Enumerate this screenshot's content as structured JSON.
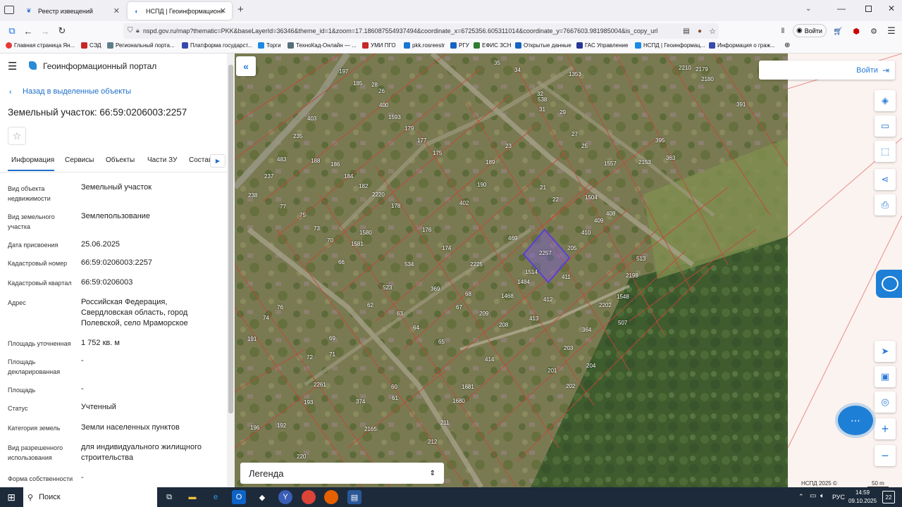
{
  "browser": {
    "tabs": [
      {
        "label": "Реестр извещений",
        "close": "✕"
      },
      {
        "label": "НСПД | Геоинформационный",
        "close": "✕"
      }
    ],
    "new_tab": "+",
    "url": "nspd.gov.ru/map?thematic=PKK&baseLayerId=36346&theme_id=1&zoom=17.186087554937494&coordinate_x=6725356.605311014&coordinate_y=7667603.981985004&is_copy_url",
    "account_label": "Войти",
    "bookmarks": [
      {
        "label": "Главная страница Ян...",
        "color": "#e53935"
      },
      {
        "label": "СЭД",
        "color": "#c62828"
      },
      {
        "label": "Региональный портa...",
        "color": "#607d8b"
      },
      {
        "label": "Платформа государст...",
        "color": "#3949ab"
      },
      {
        "label": "Торги",
        "color": "#1e88e5"
      },
      {
        "label": "ТехноКад-Онлайн — ...",
        "color": "#546e7a"
      },
      {
        "label": "УМИ ПГО",
        "color": "#c62828"
      },
      {
        "label": "pkk.rosreestr",
        "color": "#1976d2"
      },
      {
        "label": "РГУ",
        "color": "#1565c0"
      },
      {
        "label": "ЕФИС ЗСН",
        "color": "#2e7d32"
      },
      {
        "label": "Открытые данные",
        "color": "#1565c0"
      },
      {
        "label": "ГАС Управление",
        "color": "#283593"
      },
      {
        "label": "НСПД | Геоинформац...",
        "color": "#1e88e5"
      },
      {
        "label": "Информация о граж...",
        "color": "#3949ab"
      }
    ]
  },
  "panel": {
    "portal_title": "Геоинформационный портал",
    "back_link": "Назад в выделенные объекты",
    "object_title": "Земельный участок: 66:59:0206003:2257",
    "tabs": [
      "Информация",
      "Сервисы",
      "Объекты",
      "Части ЗУ",
      "Состав"
    ],
    "fields": [
      {
        "label": "Вид объекта недвижимости",
        "value": "Земельный участок"
      },
      {
        "label": "Вид земельного участка",
        "value": "Землепользование"
      },
      {
        "label": "Дата присвоения",
        "value": "25.06.2025"
      },
      {
        "label": "Кадастровый номер",
        "value": "66:59:0206003:2257"
      },
      {
        "label": "Кадастровый квартал",
        "value": "66:59:0206003"
      },
      {
        "label": "Адрес",
        "value": "Российская Федерация, Свердловская область, город Полевской, село Мраморское"
      },
      {
        "label": "Площадь уточненная",
        "value": "1 752 кв. м"
      },
      {
        "label": "Площадь декларированная",
        "value": "-"
      },
      {
        "label": "Площадь",
        "value": "-"
      },
      {
        "label": "Статус",
        "value": "Учтенный"
      },
      {
        "label": "Категория земель",
        "value": "Земли населенных пунктов"
      },
      {
        "label": "Вид разрешенного использования",
        "value": "для индивидуального жилищного строительства"
      },
      {
        "label": "Форма собственности",
        "value": "-"
      }
    ]
  },
  "map": {
    "login_label": "Войти",
    "legend_label": "Легенда",
    "selected_plot": "2257",
    "copyright": "НСПД 2025 ©",
    "scale": "50 m",
    "plot_labels": [
      "197",
      "185",
      "28",
      "400",
      "26",
      "403",
      "1593",
      "179",
      "177",
      "235",
      "188",
      "186",
      "184",
      "182",
      "175",
      "483",
      "237",
      "77",
      "238",
      "75",
      "73",
      "2220",
      "178",
      "176",
      "1580",
      "1581",
      "70",
      "66",
      "534",
      "174",
      "2225",
      "523",
      "369",
      "62",
      "63",
      "68",
      "209",
      "64",
      "67",
      "1468",
      "208",
      "413",
      "1484",
      "1514",
      "412",
      "411",
      "205",
      "410",
      "409",
      "408",
      "1504",
      "22",
      "21",
      "190",
      "402",
      "189",
      "23",
      "1557",
      "25",
      "27",
      "29",
      "31",
      "32",
      "538",
      "1353",
      "34",
      "35",
      "2153",
      "395",
      "363",
      "2210",
      "2179",
      "2180",
      "391",
      "2198",
      "513",
      "1548",
      "2202",
      "507",
      "364",
      "203",
      "204",
      "201",
      "202",
      "414",
      "1681",
      "1680",
      "211",
      "212",
      "2165",
      "60",
      "61",
      "374",
      "2261",
      "193",
      "196",
      "192",
      "220",
      "72",
      "69",
      "71",
      "65",
      "191",
      "74",
      "76",
      "469"
    ]
  },
  "taskbar": {
    "search": "Поиск",
    "lang": "РУС",
    "time": "14:59",
    "date": "09.10.2025",
    "notif": "22"
  }
}
